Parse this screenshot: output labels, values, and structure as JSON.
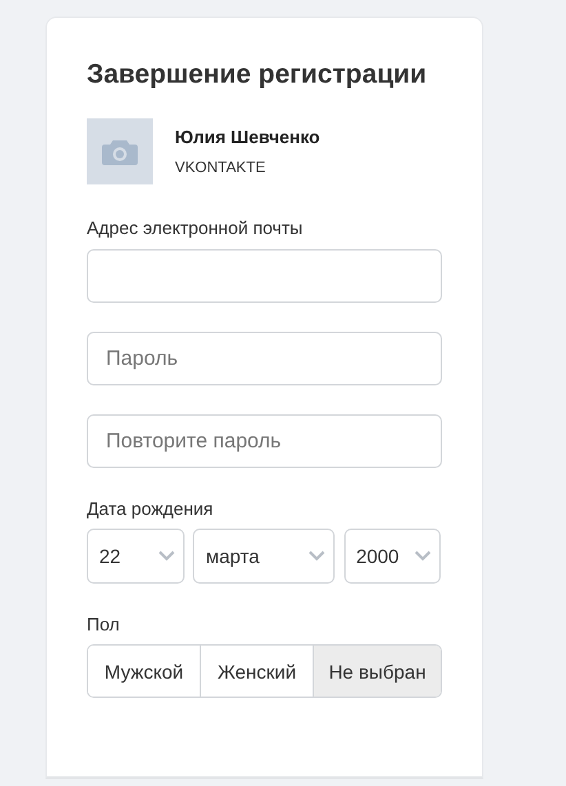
{
  "title": "Завершение регистрации",
  "profile": {
    "name": "Юлия Шевченко",
    "source": "VKONTAKTE"
  },
  "email": {
    "label": "Адрес электронной почты"
  },
  "password": {
    "placeholder": "Пароль"
  },
  "password_repeat": {
    "placeholder": "Повторите пароль"
  },
  "birth_date": {
    "label": "Дата рождения",
    "selects": [
      {
        "value": "22"
      },
      {
        "value": "марта"
      },
      {
        "value": "2000"
      }
    ]
  },
  "gender": {
    "label": "Пол",
    "options": [
      {
        "label": "Мужской",
        "selected": false
      },
      {
        "label": "Женский",
        "selected": false
      },
      {
        "label": "Не выбран",
        "selected": true
      }
    ]
  }
}
